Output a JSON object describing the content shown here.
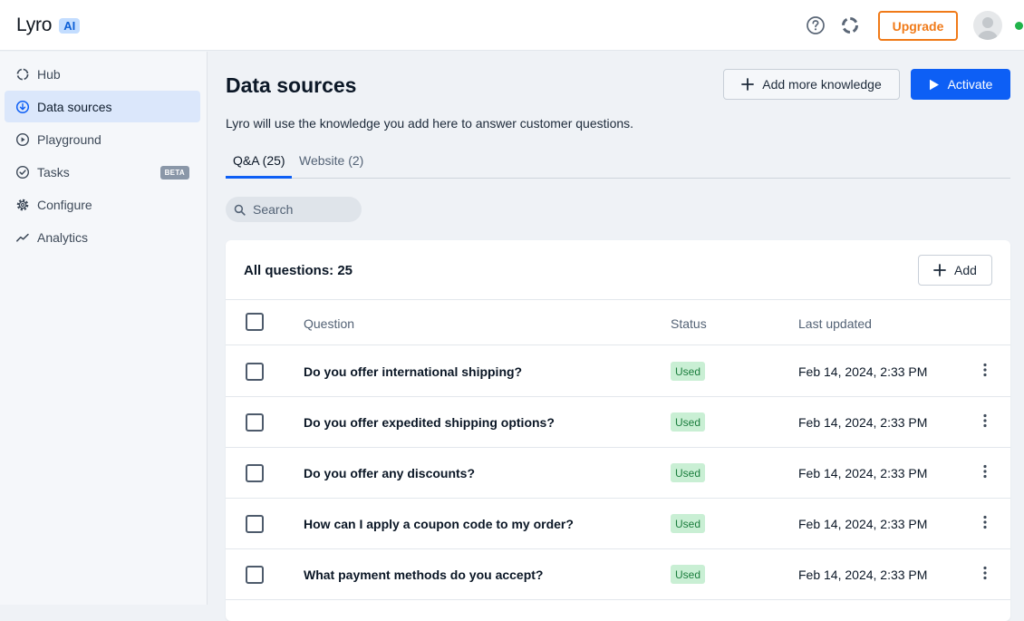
{
  "header": {
    "brand_name": "Lyro",
    "brand_badge": "AI",
    "upgrade_label": "Upgrade",
    "icons": [
      "help-circle-icon",
      "loader-icon",
      "avatar"
    ],
    "status_color": "#20b34a"
  },
  "sidebar": {
    "items": [
      {
        "label": "Hub",
        "icon": "hub-icon",
        "active": false
      },
      {
        "label": "Data sources",
        "icon": "data-sources-icon",
        "active": true
      },
      {
        "label": "Playground",
        "icon": "play-circle-icon",
        "active": false
      },
      {
        "label": "Tasks",
        "icon": "check-circle-icon",
        "active": false,
        "badge": "BETA"
      },
      {
        "label": "Configure",
        "icon": "gear-icon",
        "active": false
      },
      {
        "label": "Analytics",
        "icon": "analytics-icon",
        "active": false
      }
    ]
  },
  "main": {
    "title": "Data sources",
    "subtitle": "Lyro will use the knowledge you add here to answer customer questions.",
    "add_knowledge_label": "Add more knowledge",
    "activate_label": "Activate",
    "tabs": [
      {
        "label": "Q&A (25)",
        "active": true
      },
      {
        "label": "Website (2)",
        "active": false
      }
    ],
    "search": {
      "placeholder": "Search"
    },
    "card": {
      "title": "All questions: 25",
      "add_label": "Add",
      "columns": [
        "Question",
        "Status",
        "Last updated"
      ],
      "rows": [
        {
          "question": "Do you offer international shipping?",
          "status": "Used",
          "updated": "Feb 14, 2024, 2:33 PM"
        },
        {
          "question": "Do you offer expedited shipping options?",
          "status": "Used",
          "updated": "Feb 14, 2024, 2:33 PM"
        },
        {
          "question": "Do you offer any discounts?",
          "status": "Used",
          "updated": "Feb 14, 2024, 2:33 PM"
        },
        {
          "question": "How can I apply a coupon code to my order?",
          "status": "Used",
          "updated": "Feb 14, 2024, 2:33 PM"
        },
        {
          "question": "What payment methods do you accept?",
          "status": "Used",
          "updated": "Feb 14, 2024, 2:33 PM"
        }
      ]
    }
  },
  "colors": {
    "primary": "#0d5ff5",
    "upgrade": "#f07a18",
    "status_used_bg": "#c9efd4",
    "status_used_text": "#1a7d3c",
    "sidebar_active_bg": "#dbe7fb"
  }
}
